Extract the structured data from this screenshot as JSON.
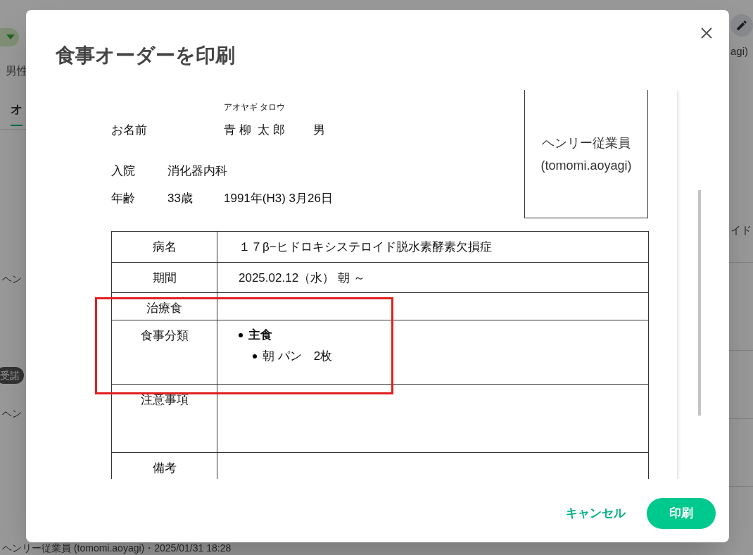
{
  "background": {
    "gender": "男性",
    "tab": {
      "label": "オ",
      "selected": true
    },
    "left_texts": [
      "ヘン",
      "ヘン",
      "ヘンリー従業員 (tomomi.aoyagi)・2025/01/31 18:28"
    ],
    "badge": "受諾",
    "right_texts": [
      "agi)",
      "イド"
    ]
  },
  "dialog": {
    "title": "食事オーダーを印刷",
    "document": {
      "furigana": "アオヤギ タロウ",
      "name_label": "お名前",
      "name": "青 柳  太 郎",
      "sex": "男",
      "admission_label": "入院",
      "department": "消化器内科",
      "age_label": "年齢",
      "age": "33歳",
      "birthdate": "1991年(H3) 3月26日",
      "staff": [
        "ヘンリー従業員",
        "(tomomi.aoyagi)"
      ],
      "rows": [
        {
          "label": "病名",
          "kind": "text",
          "value": "１７β−ヒドロキシステロイド脱水素酵素欠損症"
        },
        {
          "label": "期間",
          "kind": "text",
          "value": "2025.02.12（水） 朝 ～"
        },
        {
          "label": "治療食",
          "kind": "text"
        },
        {
          "label": "食事分類",
          "kind": "list",
          "items": [
            {
              "text": "主食",
              "children": [
                {
                  "text": "朝 パン　2枚"
                }
              ]
            }
          ]
        },
        {
          "label": "注意事項",
          "kind": "text"
        },
        {
          "label": "備考",
          "kind": "text"
        }
      ]
    },
    "buttons": [
      {
        "label": "キャンセル",
        "kind": "text"
      },
      {
        "label": "印刷",
        "kind": "primary"
      }
    ]
  }
}
